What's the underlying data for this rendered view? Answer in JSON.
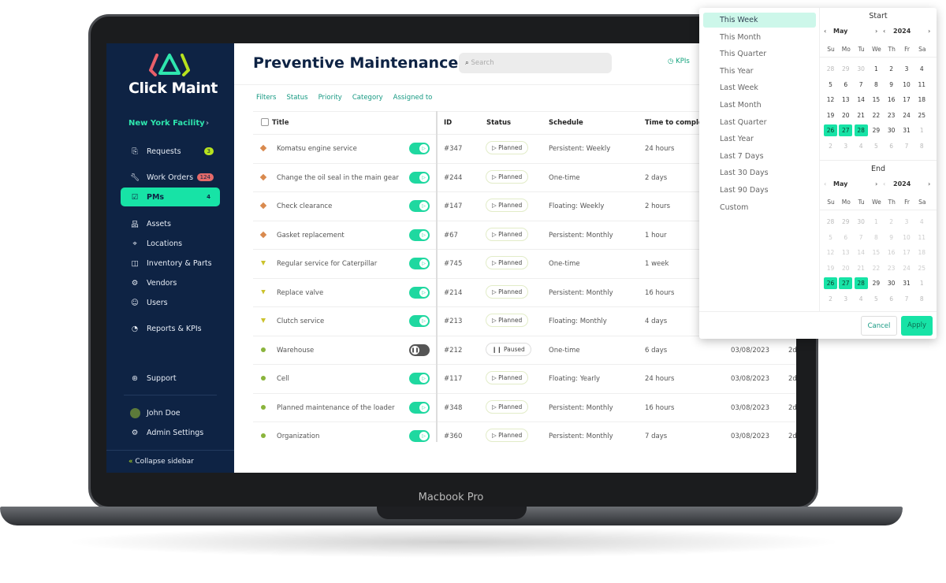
{
  "device": {
    "label": "Macbook Pro"
  },
  "sidebar": {
    "brand": "Click Maint",
    "facility": "New York Facility",
    "items": [
      {
        "label": "Requests",
        "icon": "inbox-icon",
        "badge": "3",
        "badge_color": "#b7e21e"
      },
      {
        "label": "Work Orders",
        "icon": "wrench-icon",
        "badge": "124",
        "badge_color": "#e46a6a"
      },
      {
        "label": "PMs",
        "icon": "checklist-icon",
        "badge": "4",
        "active": true
      },
      {
        "label": "Assets",
        "icon": "hierarchy-icon"
      },
      {
        "label": "Locations",
        "icon": "location-pin-icon"
      },
      {
        "label": "Inventory & Parts",
        "icon": "box-icon"
      },
      {
        "label": "Vendors",
        "icon": "vendor-icon"
      },
      {
        "label": "Users",
        "icon": "users-icon"
      },
      {
        "label": "Reports & KPIs",
        "icon": "pie-chart-icon"
      }
    ],
    "support": "Support",
    "user": "John Doe",
    "admin": "Admin Settings",
    "collapse": "Collapse sidebar"
  },
  "header": {
    "title": "Preventive Maintenance",
    "search_placeholder": "Search",
    "kpis": "KPIs"
  },
  "filters": [
    "Filters",
    "Status",
    "Priority",
    "Category",
    "Assigned to"
  ],
  "table": {
    "columns": {
      "title": "Title",
      "id": "ID",
      "status": "Status",
      "schedule": "Schedule",
      "time": "Time to complete"
    },
    "rows": [
      {
        "title": "Komatsu engine service",
        "priority": "high",
        "enabled": true,
        "id": "#347",
        "status": "Planned",
        "schedule": "Persistent: Weekly",
        "time": "24 hours"
      },
      {
        "title": "Change the oil seal in the main gear",
        "priority": "high",
        "enabled": true,
        "id": "#244",
        "status": "Planned",
        "schedule": "One-time",
        "time": "2 days"
      },
      {
        "title": "Check clearance",
        "priority": "high",
        "enabled": true,
        "id": "#147",
        "status": "Planned",
        "schedule": "Floating: Weekly",
        "time": "2 hours"
      },
      {
        "title": "Gasket replacement",
        "priority": "high",
        "enabled": true,
        "id": "#67",
        "status": "Planned",
        "schedule": "Persistent: Monthly",
        "time": "1 hour"
      },
      {
        "title": "Regular service for Caterpillar",
        "priority": "medium",
        "enabled": true,
        "id": "#745",
        "status": "Planned",
        "schedule": "One-time",
        "time": "1 week"
      },
      {
        "title": "Replace valve",
        "priority": "medium",
        "enabled": true,
        "id": "#214",
        "status": "Planned",
        "schedule": "Persistent: Monthly",
        "time": "16 hours"
      },
      {
        "title": "Clutch service",
        "priority": "medium",
        "enabled": true,
        "id": "#213",
        "status": "Planned",
        "schedule": "Floating: Monthly",
        "time": "4 days"
      },
      {
        "title": "Warehouse",
        "priority": "low",
        "enabled": false,
        "id": "#212",
        "status": "Paused",
        "schedule": "One-time",
        "time": "6 days",
        "date": "03/08/2023",
        "extra": "2d"
      },
      {
        "title": "Cell",
        "priority": "low",
        "enabled": true,
        "id": "#117",
        "status": "Planned",
        "schedule": "Floating: Yearly",
        "time": "24 hours",
        "date": "03/08/2023",
        "extra": "2d"
      },
      {
        "title": "Planned maintenance of the loader",
        "priority": "low",
        "enabled": true,
        "id": "#348",
        "status": "Planned",
        "schedule": "Persistent: Monthly",
        "time": "16 hours",
        "date": "03/08/2023",
        "extra": "2d"
      },
      {
        "title": "Organization",
        "priority": "low",
        "enabled": true,
        "id": "#360",
        "status": "Planned",
        "schedule": "Persistent: Monthly",
        "time": "7 days",
        "date": "03/08/2023",
        "extra": "2d"
      }
    ]
  },
  "priority_colors": {
    "high": "#d98a4e",
    "medium": "#cbc22c",
    "low": "#8ab43c"
  },
  "date_picker": {
    "presets": [
      "This Week",
      "This Month",
      "This Quarter",
      "This Year",
      "Last Week",
      "Last Month",
      "Last Quarter",
      "Last Year",
      "Last 7 Days",
      "Last 30 Days",
      "Last 90 Days",
      "Custom"
    ],
    "selected_preset": "This Week",
    "weekdays": [
      "Su",
      "Mo",
      "Tu",
      "We",
      "Th",
      "Fr",
      "Sa"
    ],
    "start": {
      "title": "Start",
      "month": "May",
      "year": "2024"
    },
    "end": {
      "title": "End",
      "month": "May",
      "year": "2024"
    },
    "days": [
      28,
      29,
      30,
      1,
      2,
      3,
      4,
      5,
      6,
      7,
      8,
      9,
      10,
      11,
      12,
      13,
      14,
      15,
      16,
      17,
      18,
      19,
      20,
      21,
      22,
      23,
      24,
      25,
      26,
      27,
      28,
      29,
      30,
      31,
      1,
      2,
      3,
      4,
      5,
      6,
      7,
      8
    ],
    "selected_days": [
      26,
      27,
      28
    ],
    "cancel": "Cancel",
    "apply": "Apply"
  },
  "accent": "#17e3a6"
}
